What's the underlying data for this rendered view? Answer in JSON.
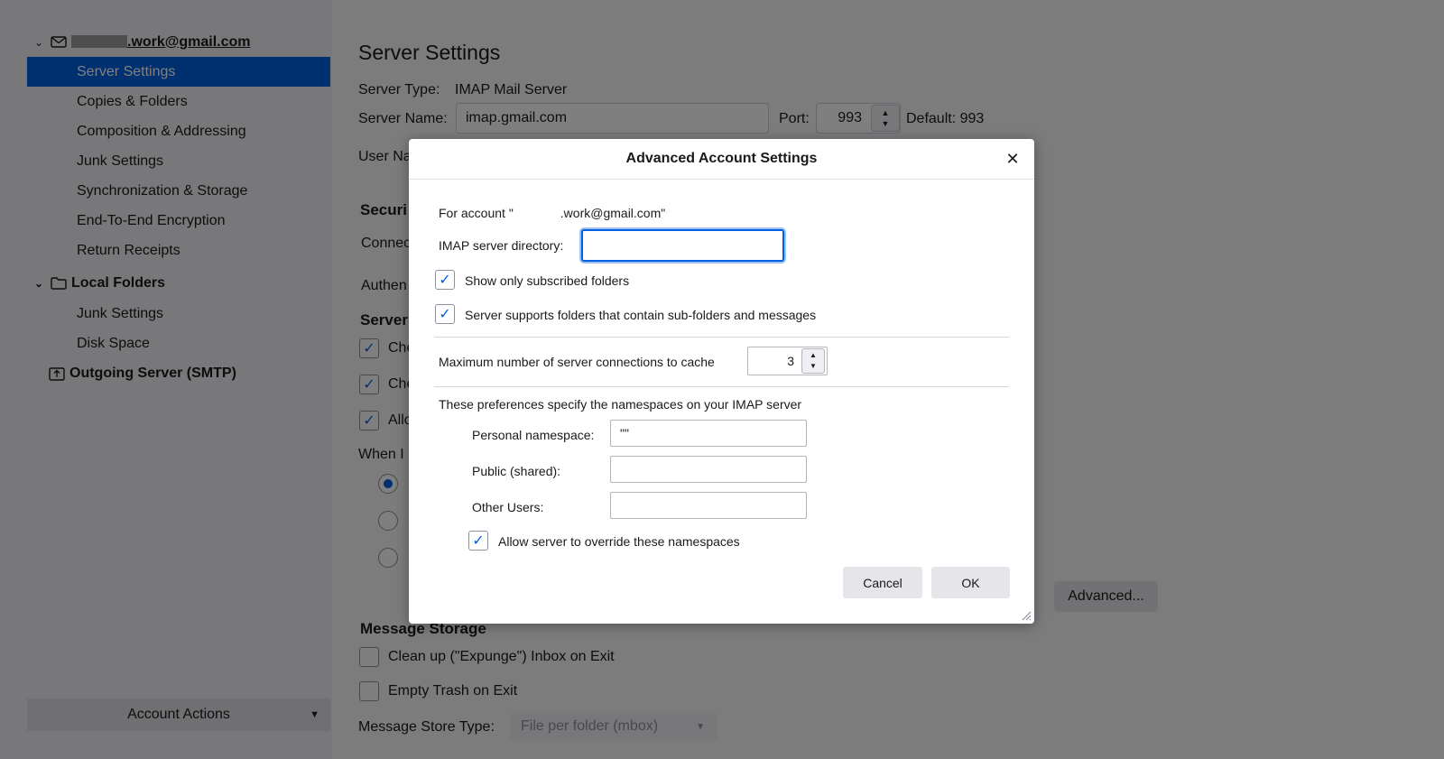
{
  "sidebar": {
    "account": {
      "name": ".work@gmail.com",
      "icon": "mail-icon"
    },
    "account_items": [
      {
        "label": "Server Settings",
        "selected": true
      },
      {
        "label": "Copies & Folders"
      },
      {
        "label": "Composition & Addressing"
      },
      {
        "label": "Junk Settings"
      },
      {
        "label": "Synchronization & Storage"
      },
      {
        "label": "End-To-End Encryption"
      },
      {
        "label": "Return Receipts"
      }
    ],
    "local_folders": {
      "name": "Local Folders",
      "icon": "folder-icon"
    },
    "local_items": [
      {
        "label": "Junk Settings"
      },
      {
        "label": "Disk Space"
      }
    ],
    "outgoing": {
      "name": "Outgoing Server (SMTP)",
      "icon": "outbox-icon"
    },
    "account_actions": "Account Actions"
  },
  "main": {
    "title": "Server Settings",
    "server_type_label": "Server Type:",
    "server_type_value": "IMAP Mail Server",
    "server_name_label": "Server Name:",
    "server_name_value": "imap.gmail.com",
    "port_label": "Port:",
    "port_value": "993",
    "default_label": "Default: 993",
    "user_name_label": "User Na",
    "security_heading": "Securi",
    "connection_label": "Connec",
    "authentication_label": "Authen",
    "server_heading": "Server",
    "check_1": "Che",
    "check_2": "Che",
    "check_3": "Allo",
    "when_label": "When I",
    "advanced_button": "Advanced...",
    "message_storage_heading": "Message Storage",
    "expunge_label": "Clean up (\"Expunge\") Inbox on Exit",
    "empty_trash_label": "Empty Trash on Exit",
    "store_type_label": "Message Store Type:",
    "store_type_value": "File per folder (mbox)"
  },
  "dialog": {
    "title": "Advanced Account Settings",
    "for_account_prefix": "For account \"",
    "for_account_suffix": ".work@gmail.com\"",
    "imap_dir_label": "IMAP server directory:",
    "imap_dir_value": "",
    "show_subscribed_label": "Show only subscribed folders",
    "show_subscribed_checked": true,
    "subfolders_label": "Server supports folders that contain sub-folders and messages",
    "subfolders_checked": true,
    "max_connections_label": "Maximum number of server connections to cache",
    "max_connections_value": "3",
    "namespaces_intro": "These preferences specify the namespaces on your IMAP server",
    "personal_ns_label": "Personal namespace:",
    "personal_ns_value": "\"\"",
    "public_ns_label": "Public (shared):",
    "public_ns_value": "",
    "other_users_label": "Other Users:",
    "other_users_value": "",
    "allow_override_label": "Allow server to override these namespaces",
    "allow_override_checked": true,
    "cancel_button": "Cancel",
    "ok_button": "OK",
    "close_icon": "close-icon"
  },
  "colors": {
    "accent": "#0061e0",
    "selected_bg": "#0061e0",
    "overlay": "rgba(0,0,0,0.5)"
  }
}
